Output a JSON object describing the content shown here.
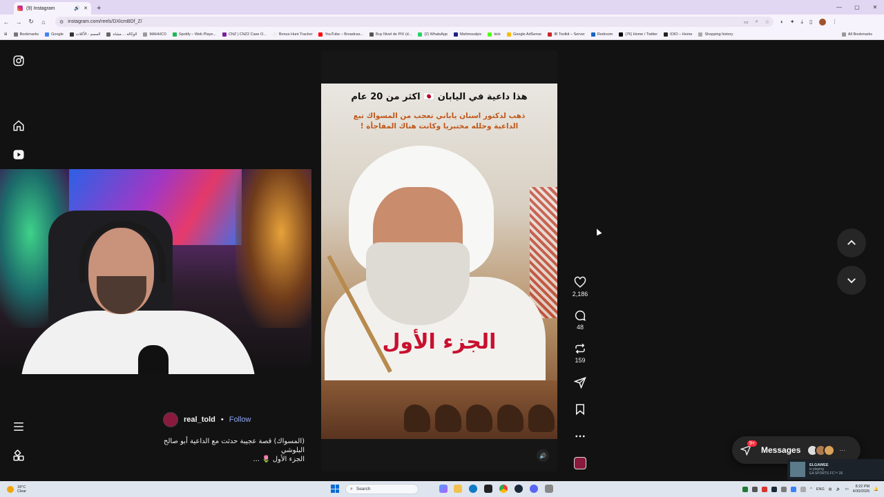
{
  "browser": {
    "tab_title": "(9) Instagram",
    "new_tab_label": "+",
    "url": "instagram.com/reels/DXlcmBDf_Z/",
    "window_controls": [
      "—",
      "▢",
      "✕"
    ]
  },
  "bookmarks": [
    "Bookmarks",
    "Google",
    "المسم - الأكلات",
    "الوكالة ... مشاه",
    "MAHHCO",
    "Spotify – Web Playe...",
    "CNZ | CNZ2 Case O...",
    "Bonus Hunt Tracker",
    "YouTube – Broadcas...",
    "Buy Nivel de PIX (d...",
    "(2) WhatsApp",
    "Mahmoudpic",
    "kick",
    "Google AdSense",
    "IB Toolkit – Server",
    "Redroom",
    "(76) Home / Twitter",
    "IOIO – Home",
    "Shopping history"
  ],
  "bookmarks_all": "All Bookmarks",
  "sidebar": {
    "items": [
      "instagram-logo",
      "home",
      "reels",
      "more",
      "also-from-meta"
    ]
  },
  "reel": {
    "author": "real_told",
    "dot": "•",
    "follow_label": "Follow",
    "caption_line1": "(المسواك) قصة عجيبة حدثت مع الداعية أبو صالح البلوشي",
    "caption_line2": "الجزء الأول 🌷 ...",
    "overlay_title": "هذا داعية في اليابان 🇯🇵 اكثر من 20 عام",
    "overlay_subtitle": "ذهب لدكتور اسنان ياباني تعجب من المسواك تبع الداعية وحلله مختبريا وكانت هناك المفاجأة !",
    "overlay_part": "الجزء الأول",
    "likes": "2,186",
    "comments": "48",
    "reposts": "159"
  },
  "messages": {
    "label": "Messages",
    "badge": "9+"
  },
  "steam_toast": {
    "name": "ELGAWEE",
    "status": "is playing",
    "game": "EA SPORTS FC™ 26"
  },
  "taskbar": {
    "weather_temp": "18°C",
    "weather_desc": "Clear",
    "search_placeholder": "Search",
    "lang": "ENG",
    "time": "8:22 PM",
    "date": "4/30/2026"
  },
  "colors": {
    "background": "#121212",
    "follow": "#8ea6f5",
    "badge": "#ff3040"
  }
}
